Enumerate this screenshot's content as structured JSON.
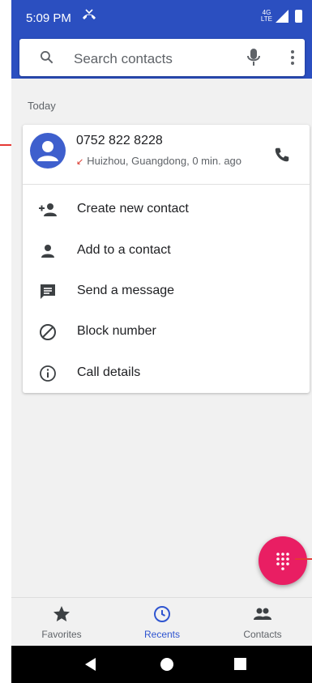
{
  "status_bar": {
    "time": "5:09 PM",
    "missed_call_icon": "missed-call-icon",
    "network": "4G LTE"
  },
  "search": {
    "placeholder": "Search contacts"
  },
  "section": {
    "label": "Today"
  },
  "call_entry": {
    "number": "0752 822 8228",
    "detail": "Huizhou, Guangdong, 0 min. ago",
    "missed_indicator": "↙"
  },
  "menu": {
    "items": [
      {
        "label": "Create new contact",
        "icon": "person-add-icon"
      },
      {
        "label": "Add to a contact",
        "icon": "person-icon"
      },
      {
        "label": "Send a message",
        "icon": "message-icon"
      },
      {
        "label": "Block number",
        "icon": "block-icon"
      },
      {
        "label": "Call details",
        "icon": "info-icon"
      }
    ]
  },
  "bottom_nav": {
    "favorites": "Favorites",
    "recents": "Recents",
    "contacts": "Contacts"
  },
  "colors": {
    "accent": "#2b4fc0",
    "fab": "#e91e63",
    "active_tab": "#2f55d0"
  }
}
